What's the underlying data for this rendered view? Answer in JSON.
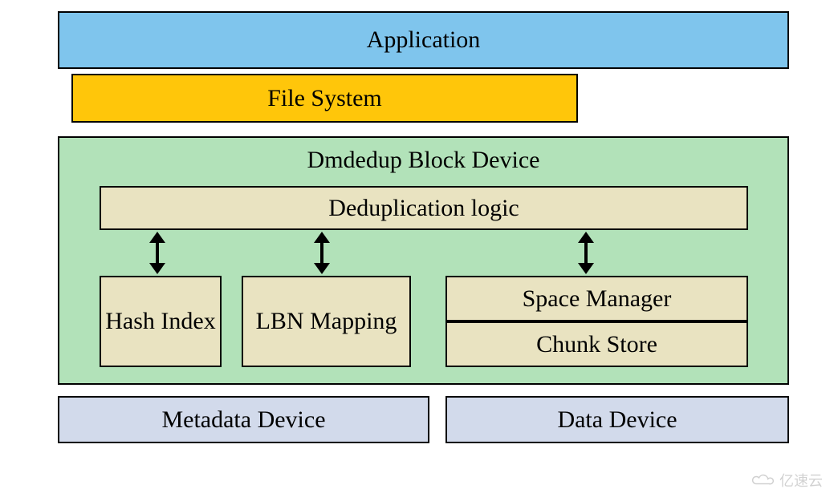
{
  "layers": {
    "application": "Application",
    "filesystem": "File System",
    "dmdedup": {
      "title": "Dmdedup Block Device",
      "dedup_logic": "Deduplication logic",
      "components": {
        "hash_index": "Hash Index",
        "lbn_mapping": "LBN Mapping",
        "space_manager": "Space Manager",
        "chunk_store": "Chunk Store"
      }
    },
    "devices": {
      "metadata": "Metadata Device",
      "data": "Data Device"
    }
  },
  "watermark": "亿速云"
}
